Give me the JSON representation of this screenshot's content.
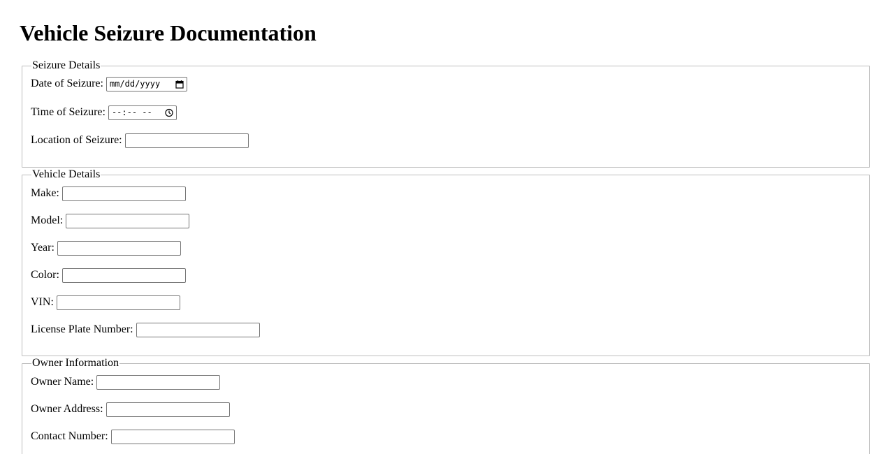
{
  "form": {
    "title": "Vehicle Seizure Documentation",
    "sections": {
      "seizure": {
        "legend": "Seizure Details",
        "date_label": "Date of Seizure:",
        "date_placeholder": "mm/dd/yyyy",
        "time_label": "Time of Seizure:",
        "time_placeholder": "--:-- --",
        "location_label": "Location of Seizure:"
      },
      "vehicle": {
        "legend": "Vehicle Details",
        "make_label": "Make:",
        "model_label": "Model:",
        "year_label": "Year:",
        "color_label": "Color:",
        "vin_label": "VIN:",
        "plate_label": "License Plate Number:"
      },
      "owner": {
        "legend": "Owner Information",
        "name_label": "Owner Name:",
        "address_label": "Owner Address:",
        "contact_label": "Contact Number:"
      }
    }
  },
  "icons": {
    "date": "calendar-icon",
    "time": "clock-icon"
  }
}
